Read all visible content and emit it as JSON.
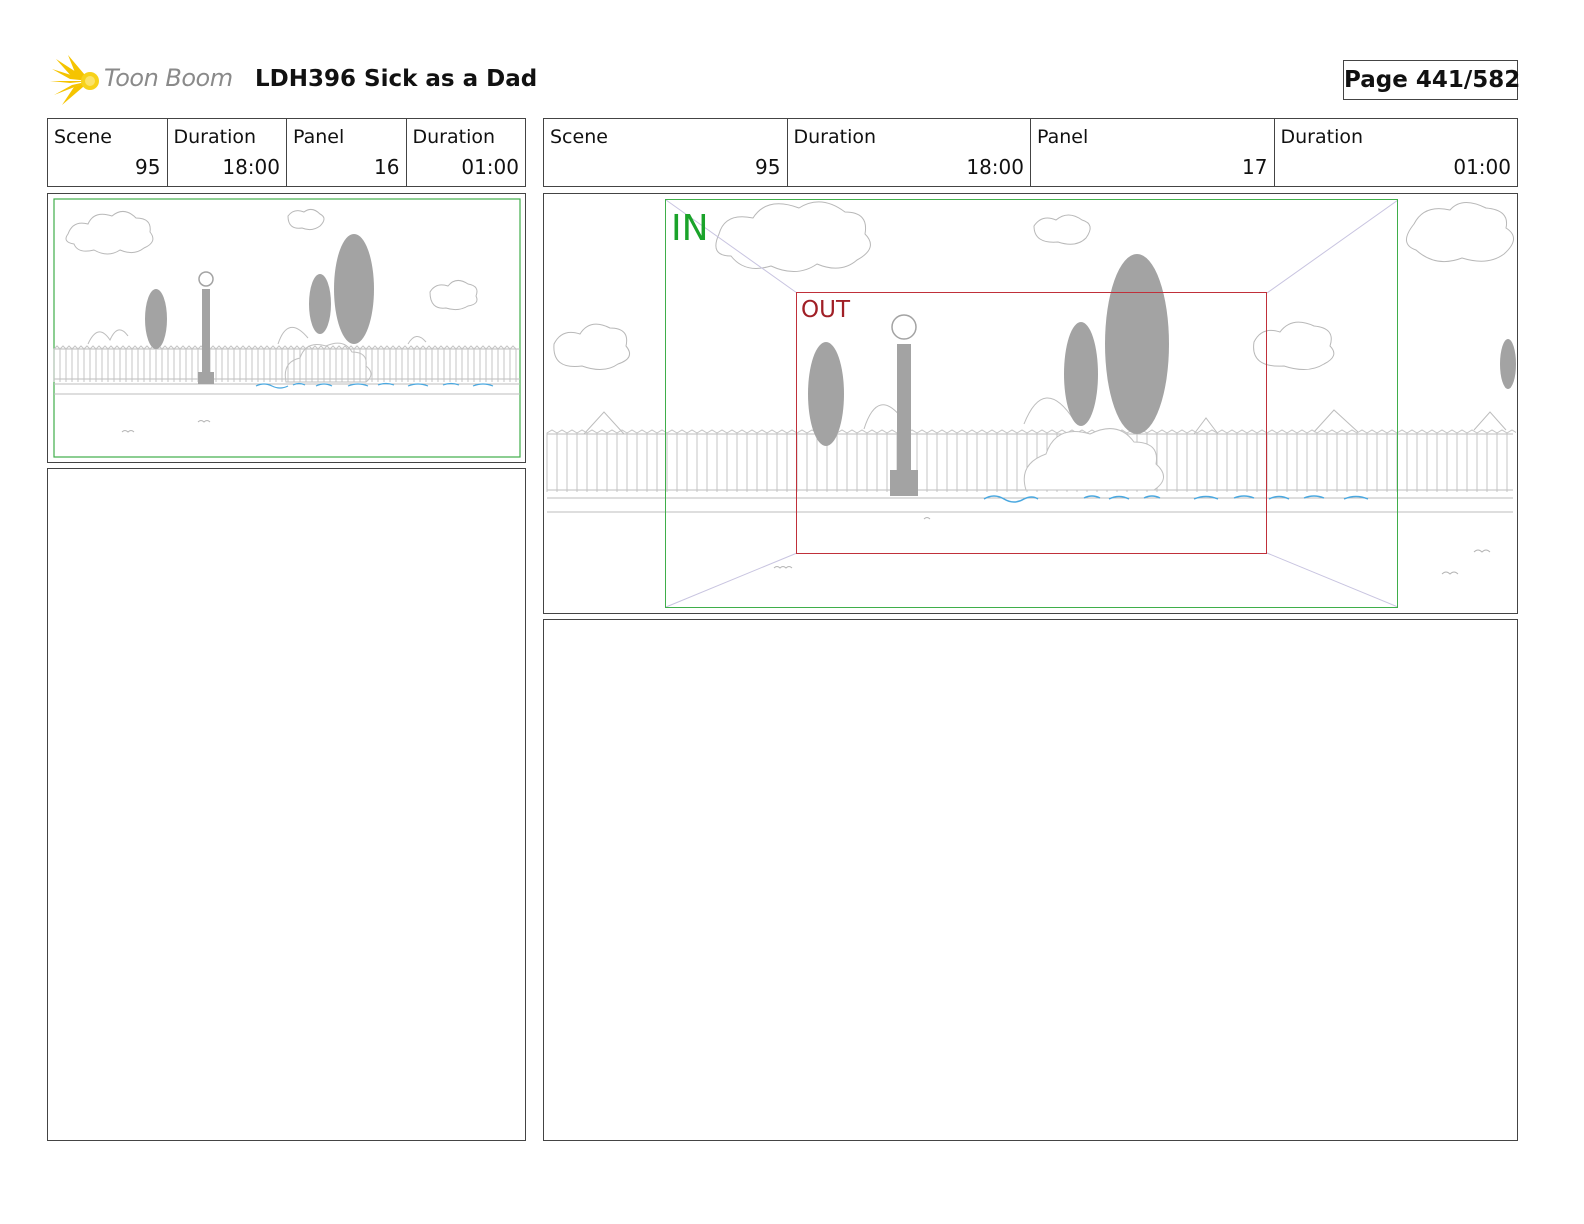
{
  "header": {
    "logo_text": "Toon Boom",
    "title": "LDH396 Sick as a Dad",
    "page_label": "Page 441/582"
  },
  "panels": [
    {
      "scene_label": "Scene",
      "scene": "95",
      "duration_label": "Duration",
      "duration": "18:00",
      "panel_label": "Panel",
      "panel": "16",
      "panel_duration_label": "Duration",
      "panel_duration": "01:00"
    },
    {
      "scene_label": "Scene",
      "scene": "95",
      "duration_label": "Duration",
      "duration": "18:00",
      "panel_label": "Panel",
      "panel": "17",
      "panel_duration_label": "Duration",
      "panel_duration": "01:00",
      "frame_in_label": "IN",
      "frame_out_label": "OUT"
    }
  ],
  "colors": {
    "frame_in": "#3fae4a",
    "frame_out": "#c0303a",
    "sketch_grey": "#9a9a9a",
    "water_blue": "#4aa8e0",
    "logo_yellow": "#f5c400"
  }
}
